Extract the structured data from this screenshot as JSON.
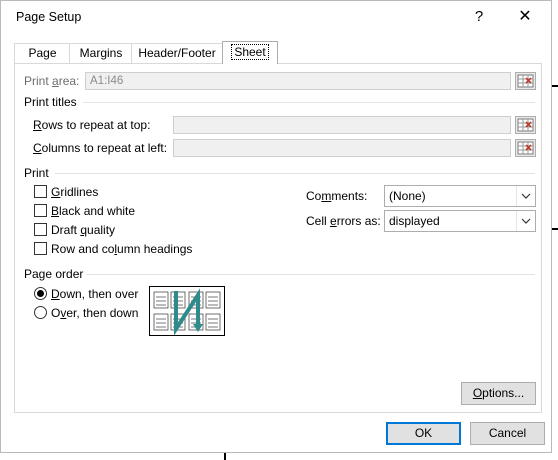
{
  "dialog": {
    "title": "Page Setup",
    "help_glyph": "?",
    "close_glyph": "✕"
  },
  "tabs": [
    {
      "label": "Page"
    },
    {
      "label": "Margins"
    },
    {
      "label": "Header/Footer"
    },
    {
      "label": "Sheet",
      "active": true
    }
  ],
  "print_area": {
    "label_pre": "Print ",
    "label_u": "a",
    "label_post": "rea:",
    "value": "A1:I46"
  },
  "print_titles": {
    "header": "Print titles",
    "rows_pre": "",
    "rows_u": "R",
    "rows_post": "ows to repeat at top:",
    "cols_pre": "",
    "cols_u": "C",
    "cols_post": "olumns to repeat at left:"
  },
  "print": {
    "header": "Print",
    "checkboxes": [
      {
        "pre": "",
        "u": "G",
        "post": "ridlines",
        "checked": false
      },
      {
        "pre": "",
        "u": "B",
        "post": "lack and white",
        "checked": false
      },
      {
        "pre": "Draft ",
        "u": "q",
        "post": "uality",
        "checked": false
      },
      {
        "pre": "Row and co",
        "u": "l",
        "post": "umn headings",
        "checked": false
      }
    ],
    "comments_pre": "Co",
    "comments_u": "m",
    "comments_post": "ments:",
    "comments_value": "(None)",
    "errors_pre": "Cell ",
    "errors_u": "e",
    "errors_post": "rrors as:",
    "errors_value": "displayed"
  },
  "page_order": {
    "header": "Page order",
    "options": [
      {
        "pre": "",
        "u": "D",
        "post": "own, then over",
        "selected": true
      },
      {
        "pre": "O",
        "u": "v",
        "post": "er, then down",
        "selected": false
      }
    ]
  },
  "buttons": {
    "options_pre": "",
    "options_u": "O",
    "options_post": "ptions...",
    "ok": "OK",
    "cancel": "Cancel"
  },
  "colors": {
    "accent": "#0078d7",
    "order_arrow": "#2e8b8b"
  }
}
